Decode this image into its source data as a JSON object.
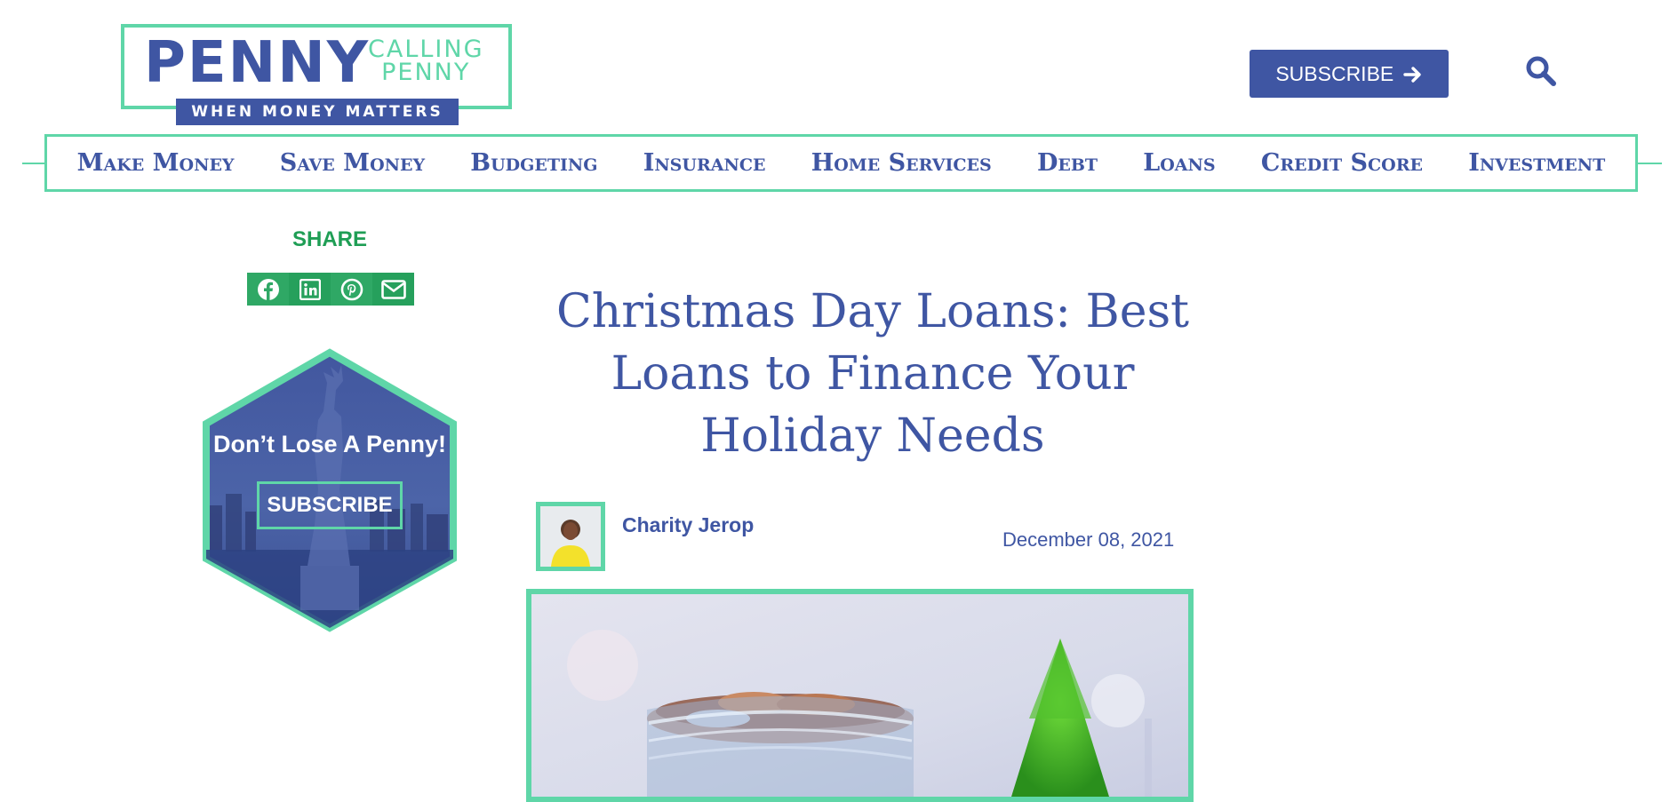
{
  "logo": {
    "main": "PENNY",
    "side_line1": "CALLING",
    "side_line2": "PENNY",
    "tagline": "WHEN MONEY MATTERS"
  },
  "header": {
    "subscribe_label": "SUBSCRIBE",
    "icons": [
      "arrow-right-icon",
      "search-icon"
    ]
  },
  "nav": {
    "items": [
      {
        "label": "Make Money"
      },
      {
        "label": "Save Money"
      },
      {
        "label": "Budgeting"
      },
      {
        "label": "Insurance"
      },
      {
        "label": "Home Services"
      },
      {
        "label": "Debt"
      },
      {
        "label": "Loans"
      },
      {
        "label": "Credit Score"
      },
      {
        "label": "Investment"
      }
    ]
  },
  "share": {
    "label": "SHARE",
    "buttons": [
      "facebook-icon",
      "linkedin-icon",
      "pinterest-icon",
      "email-icon"
    ]
  },
  "promo": {
    "title": "Don’t Lose A Penny!",
    "button_label": "SUBSCRIBE"
  },
  "article": {
    "title": "Christmas Day Loans: Best Loans to Finance Your Holiday Needs",
    "author": "Charity Jerop",
    "date": "December 08, 2021"
  },
  "colors": {
    "brand_blue": "#3f56a3",
    "accent_green": "#5fd6a8",
    "share_green": "#2fa865"
  }
}
